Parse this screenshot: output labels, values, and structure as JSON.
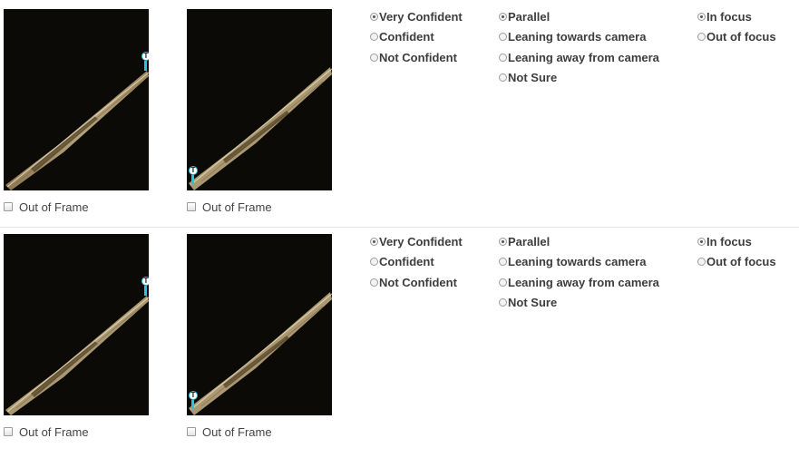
{
  "rows": [
    {
      "out_of_frame_1": "Out of Frame",
      "out_of_frame_2": "Out of Frame",
      "confidence": [
        "Very Confident",
        "Confident",
        "Not Confident"
      ],
      "orientation": [
        "Parallel",
        "Leaning towards camera",
        "Leaning away from camera",
        "Not Sure"
      ],
      "focus": [
        "In focus",
        "Out of focus"
      ],
      "marker_label": "T"
    },
    {
      "out_of_frame_1": "Out of Frame",
      "out_of_frame_2": "Out of Frame",
      "confidence": [
        "Very Confident",
        "Confident",
        "Not Confident"
      ],
      "orientation": [
        "Parallel",
        "Leaning towards camera",
        "Leaning away from camera",
        "Not Sure"
      ],
      "focus": [
        "In focus",
        "Out of focus"
      ],
      "marker_label": "T"
    }
  ],
  "selected": {
    "confidence": "Very Confident",
    "orientation": "Parallel",
    "focus": "In focus",
    "out_of_frame": false
  },
  "colors": {
    "marker": "#2ec4d8",
    "image_background": "#0c0a07",
    "specimen": "#c9b48a"
  }
}
